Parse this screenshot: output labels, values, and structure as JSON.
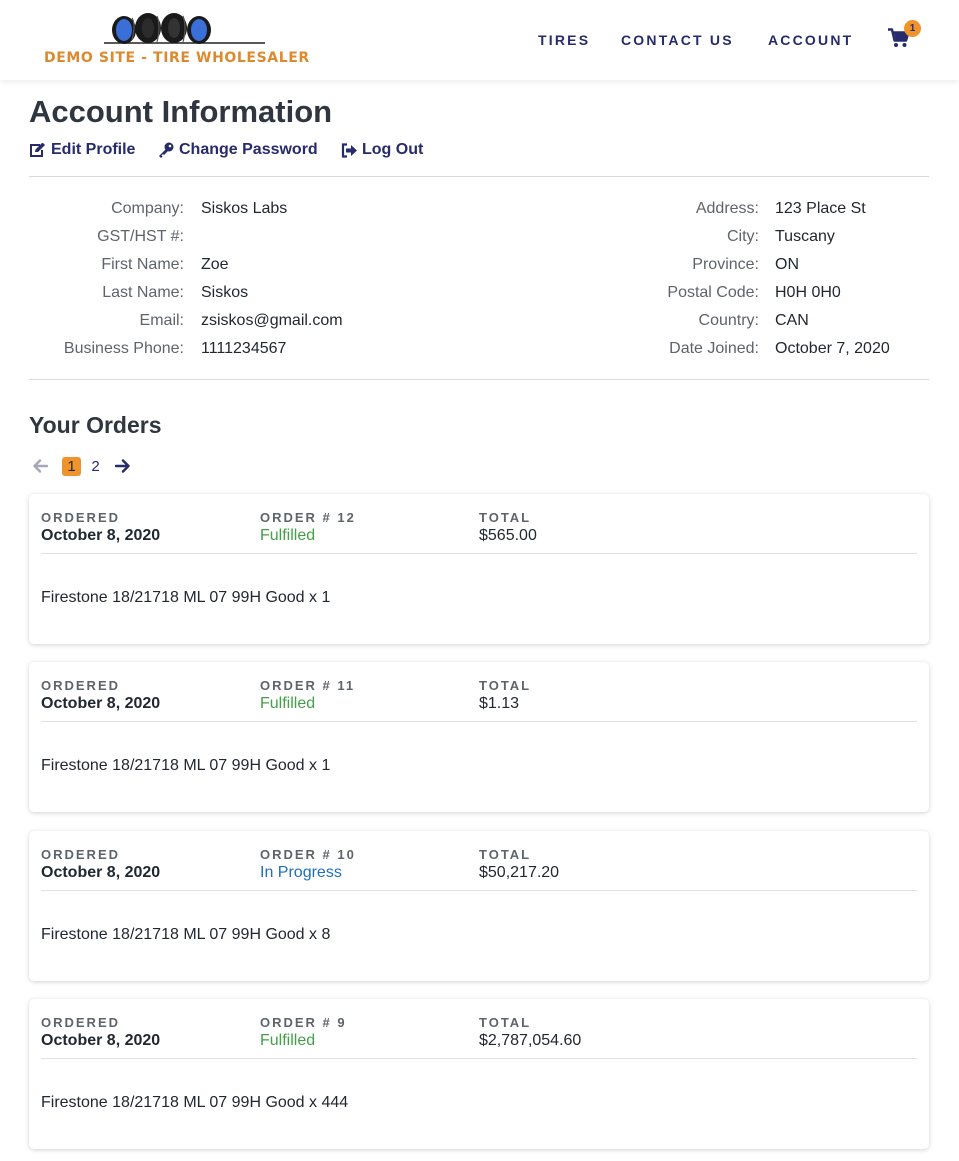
{
  "brand": {
    "site_name": "DEMO SITE - TIRE WHOLESALER",
    "logo_icon": "tires-logo",
    "accent_color": "#dd8a2e",
    "nav_color": "#262b6b"
  },
  "nav": {
    "items": [
      {
        "label": "TIRES"
      },
      {
        "label": "CONTACT US"
      },
      {
        "label": "ACCOUNT"
      }
    ],
    "cart_icon": "shopping-cart-icon",
    "cart_count": "1"
  },
  "account": {
    "title": "Account Information",
    "actions": [
      {
        "label": "Edit Profile",
        "icon": "edit-icon"
      },
      {
        "label": "Change Password",
        "icon": "key-icon"
      },
      {
        "label": "Log Out",
        "icon": "sign-out-icon"
      }
    ],
    "left_fields": [
      {
        "label": "Company:",
        "value": "Siskos Labs"
      },
      {
        "label": "GST/HST #:",
        "value": ""
      },
      {
        "label": "First Name:",
        "value": "Zoe"
      },
      {
        "label": "Last Name:",
        "value": "Siskos"
      },
      {
        "label": "Email:",
        "value": "zsiskos@gmail.com"
      },
      {
        "label": "Business Phone:",
        "value": "1111234567"
      }
    ],
    "right_fields": [
      {
        "label": "Address:",
        "value": "123 Place St"
      },
      {
        "label": "City:",
        "value": "Tuscany"
      },
      {
        "label": "Province:",
        "value": "ON"
      },
      {
        "label": "Postal Code:",
        "value": "H0H 0H0"
      },
      {
        "label": "Country:",
        "value": "CAN"
      },
      {
        "label": "Date Joined:",
        "value": "October 7, 2020"
      }
    ]
  },
  "orders": {
    "title": "Your Orders",
    "pager": {
      "prev_icon": "arrow-left-icon",
      "next_icon": "arrow-right-icon",
      "pages": [
        "1",
        "2"
      ],
      "current": "1"
    },
    "headers": {
      "ordered": "ORDERED",
      "total": "TOTAL"
    },
    "list": [
      {
        "number_label": "ORDER # 12",
        "date": "October 8, 2020",
        "status": "Fulfilled",
        "status_color": "#43a047",
        "total": "$565.00",
        "item": "Firestone 18/21718 ML 07 99H Good x 1"
      },
      {
        "number_label": "ORDER # 11",
        "date": "October 8, 2020",
        "status": "Fulfilled",
        "status_color": "#43a047",
        "total": "$1.13",
        "item": "Firestone 18/21718 ML 07 99H Good x 1"
      },
      {
        "number_label": "ORDER # 10",
        "date": "October 8, 2020",
        "status": "In Progress",
        "status_color": "#1e6fbf",
        "total": "$50,217.20",
        "item": "Firestone 18/21718 ML 07 99H Good x 8"
      },
      {
        "number_label": "ORDER # 9",
        "date": "October 8, 2020",
        "status": "Fulfilled",
        "status_color": "#43a047",
        "total": "$2,787,054.60",
        "item": "Firestone 18/21718 ML 07 99H Good x 444"
      }
    ]
  }
}
